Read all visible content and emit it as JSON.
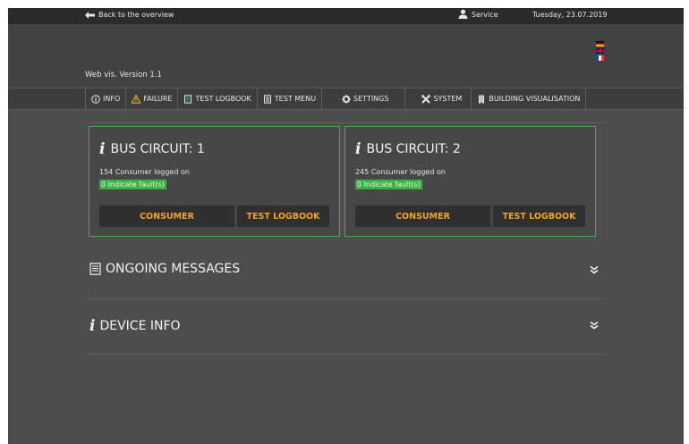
{
  "topbar": {
    "back_label": "Back to the overview",
    "service_label": "Service",
    "date": "Tuesday, 23.07.2019"
  },
  "header": {
    "version": "Web vis. Version 1.1",
    "languages": [
      "de",
      "en",
      "fr"
    ]
  },
  "nav": {
    "items": [
      {
        "label": "INFO",
        "icon": "info-circle-icon"
      },
      {
        "label": "FAILURE",
        "icon": "warning-triangle-icon"
      },
      {
        "label": "TEST LOGBOOK",
        "icon": "logbook-icon"
      },
      {
        "label": "TEST MENU",
        "icon": "document-icon"
      },
      {
        "label": "SETTINGS",
        "icon": "gear-icon"
      },
      {
        "label": "SYSTEM",
        "icon": "tools-icon"
      },
      {
        "label": "BUILDING VISUALISATION",
        "icon": "building-icon"
      }
    ]
  },
  "circuits": [
    {
      "title": "BUS CIRCUIT: 1",
      "consumers": "154 Consumer logged on",
      "faults": "0 Indicate fault(s)",
      "consumer_button": "CONSUMER",
      "logbook_button": "TEST LOGBOOK"
    },
    {
      "title": "BUS CIRCUIT: 2",
      "consumers": "245 Consumer logged on",
      "faults": "0 Indicate fault(s)",
      "consumer_button": "CONSUMER",
      "logbook_button": "TEST LOGBOOK"
    }
  ],
  "sections": {
    "ongoing": {
      "title": "ONGOING MESSAGES",
      "icon": "messages-icon"
    },
    "device": {
      "title": "DEVICE INFO",
      "icon": "info-icon"
    }
  },
  "colors": {
    "accent": "#f2a51c",
    "ok_green": "#3cb043",
    "card_border": "#39b54a",
    "background": "#4a4a4a"
  }
}
